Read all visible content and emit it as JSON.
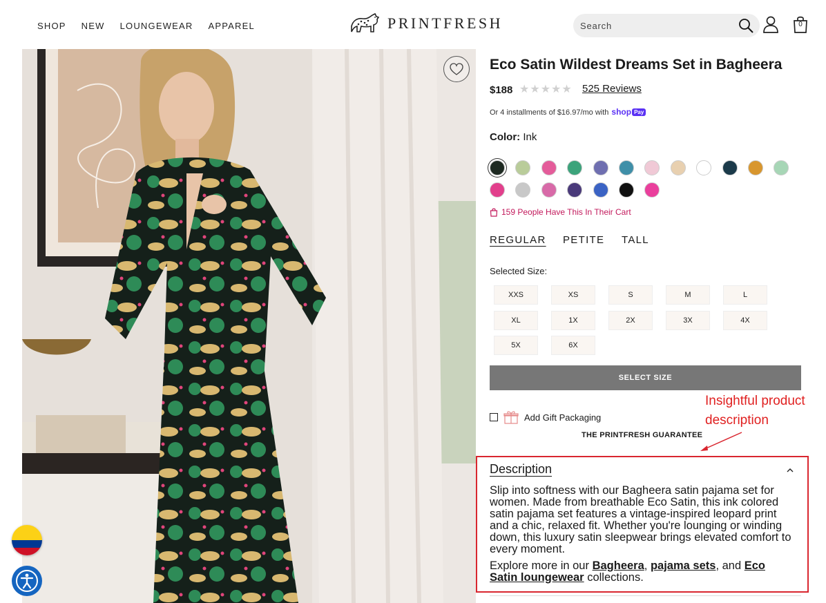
{
  "nav": {
    "items": [
      "SHOP",
      "NEW",
      "LOUNGEWEAR",
      "APPAREL"
    ]
  },
  "brand": {
    "name": "PRINTFRESH"
  },
  "search": {
    "placeholder": "Search"
  },
  "cart": {
    "count": "0"
  },
  "product": {
    "title": "Eco Satin Wildest Dreams Set in Bagheera",
    "price": "$188",
    "stars": "★★★★★",
    "reviews": "525 Reviews",
    "installments": "Or 4 installments of $16.97/mo with",
    "shop_pay_brand": "shop",
    "shop_pay_badge": "Pay",
    "color_label": "Color:",
    "color_value": "Ink",
    "swatch_colors": [
      "#1e2a22",
      "#b9cc9a",
      "#e45c9a",
      "#3ca37b",
      "#6f6fb0",
      "#3f8fa8",
      "#f0c9d6",
      "#e8d0b0",
      "#ffffff",
      "#1b3a4a",
      "#d8962e",
      "#a7d6b6",
      "#e23f8c",
      "#c8c8c8",
      "#d86aa8",
      "#4a3a7a",
      "#3b63c4",
      "#111111",
      "#ea3f9c"
    ],
    "cart_note": "159 People Have This In Their Cart",
    "fits": [
      "REGULAR",
      "PETITE",
      "TALL"
    ],
    "selected_size_label": "Selected Size:",
    "sizes": [
      "XXS",
      "XS",
      "S",
      "M",
      "L",
      "XL",
      "1X",
      "2X",
      "3X",
      "4X",
      "5X",
      "6X"
    ],
    "select_size_button": "SELECT SIZE",
    "gift_label": "Add Gift Packaging",
    "guarantee": "THE PRINTFRESH GUARANTEE",
    "description": {
      "title": "Description",
      "paragraph": "Slip into softness with our Bagheera satin pajama set for women. Made from breathable Eco Satin, this ink colored satin pajama set features a vintage-inspired leopard print and a chic, relaxed fit. Whether you're lounging or winding down, this luxury satin sleepwear brings elevated comfort to every moment.",
      "explore_prefix": "Explore more in our ",
      "link_1": "Bagheera",
      "sep_1": ", ",
      "link_2": "pajama sets",
      "sep_2": ", and ",
      "link_3": "Eco Satin loungewear",
      "explore_suffix": " collections."
    }
  },
  "annotation": {
    "line1": "Insightful product",
    "line2": "description"
  },
  "colors": {
    "accent_red": "#d9262f",
    "cart_note_pink": "#c2185b",
    "shop_pay": "#5a31f4",
    "button_gray": "#777777"
  }
}
